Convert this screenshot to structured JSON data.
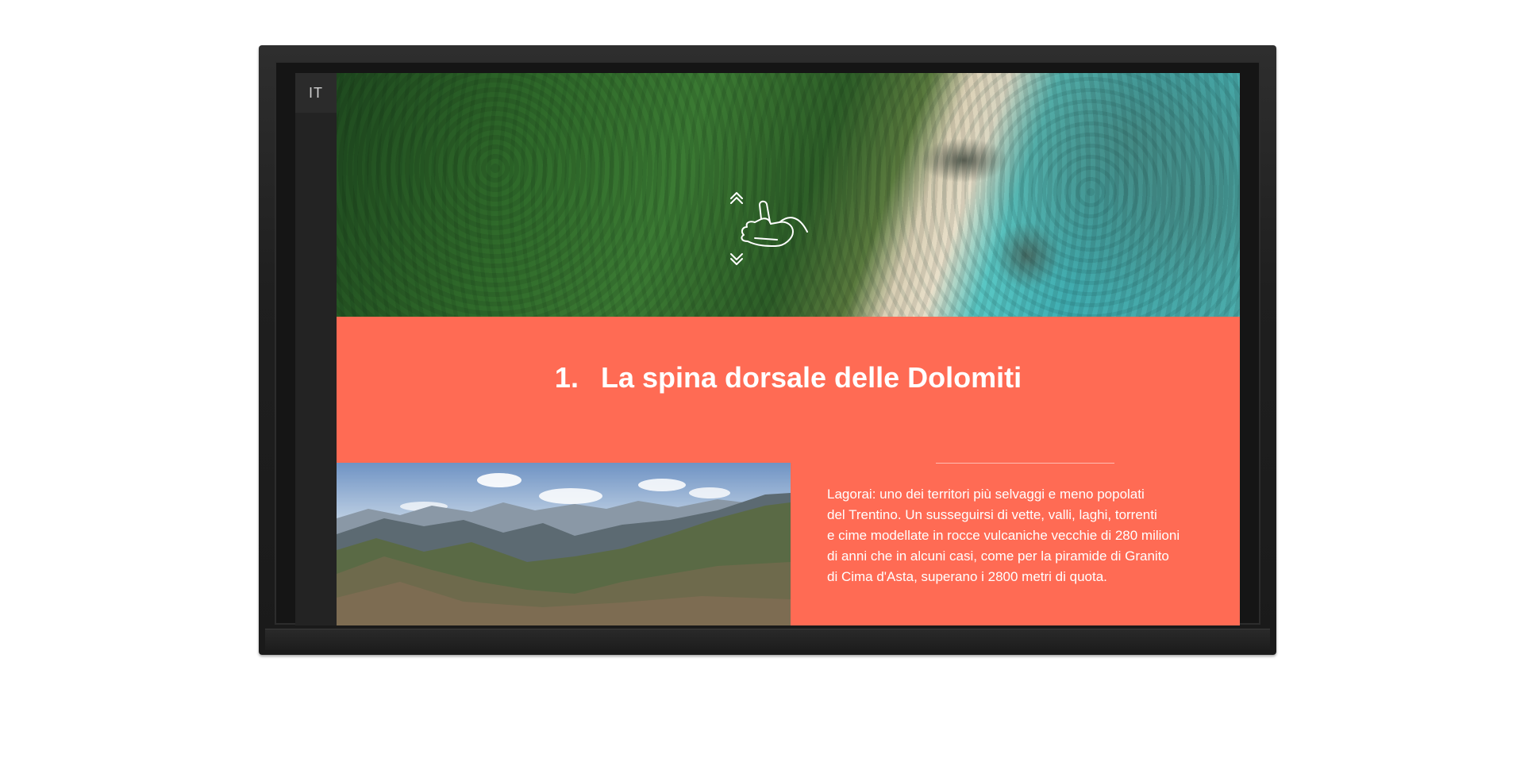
{
  "language": {
    "code": "IT"
  },
  "gesture": {
    "icon": "swipe-hand-icon",
    "arrows": [
      "chevron-up-double-icon",
      "chevron-down-double-icon"
    ]
  },
  "slide": {
    "number": "1.",
    "title": "La spina dorsale delle Dolomiti",
    "body_lines": [
      "Lagorai: uno dei territori più selvaggi e meno popolati",
      "del Trentino. Un susseguirsi di vette, valli, laghi, torrenti",
      "e cime modellate in rocce vulcaniche vecchie di 280 milioni",
      "di anni che in alcuni casi, come per la piramide di Granito",
      "di Cima d'Asta, superano i 2800 metri di quota."
    ]
  },
  "colors": {
    "accent": "#ff6b54",
    "rail": "#232323",
    "bezel": "#1d1d1d"
  }
}
